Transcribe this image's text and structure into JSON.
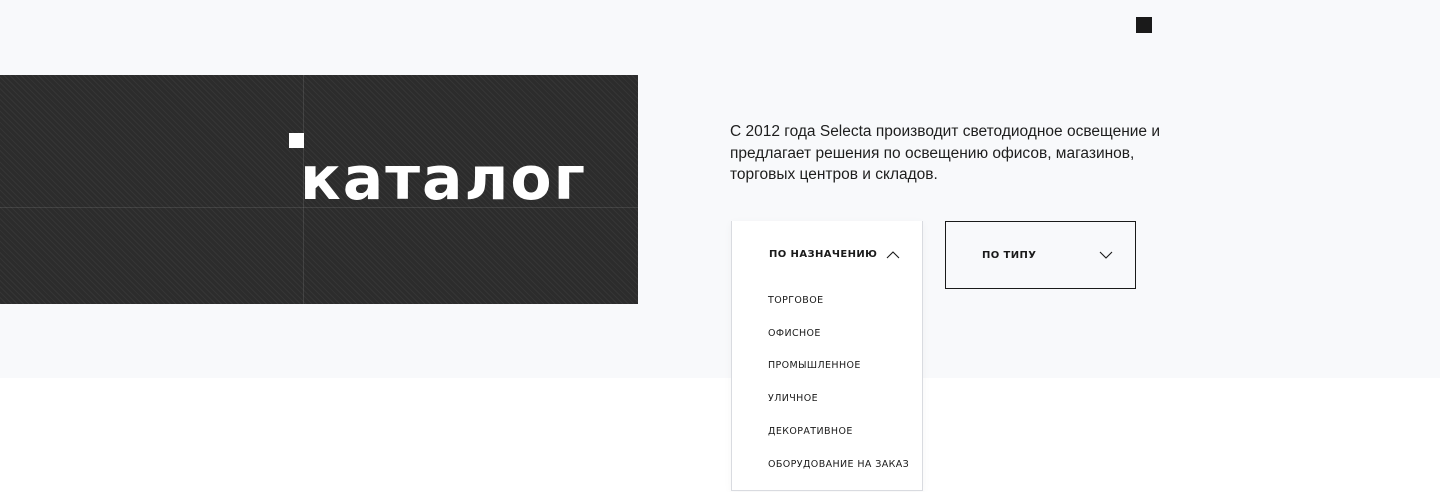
{
  "colors": {
    "hero_background": "#f8f9fb",
    "banner": "#2c2c2c",
    "text": "#1c1c1c",
    "white": "#ffffff"
  },
  "banner": {
    "title": "каталог"
  },
  "intro": {
    "text": "С 2012 года Selecta производит светодиодное освещение и предлагает решения по освещению офисов, магазинов, торговых центров и складов."
  },
  "filters": {
    "purpose": {
      "label": "ПО НАЗНАЧЕНИЮ",
      "expanded": true,
      "icon": "chevron-up-icon",
      "options": [
        "ТОРГОВОЕ",
        "ОФИСНОЕ",
        "ПРОМЫШЛЕННОЕ",
        "УЛИЧНОЕ",
        "ДЕКОРАТИВНОЕ",
        "ОБОРУДОВАНИЕ НА ЗАКАЗ"
      ]
    },
    "type": {
      "label": "ПО ТИПУ",
      "expanded": false,
      "icon": "chevron-down-icon"
    }
  }
}
